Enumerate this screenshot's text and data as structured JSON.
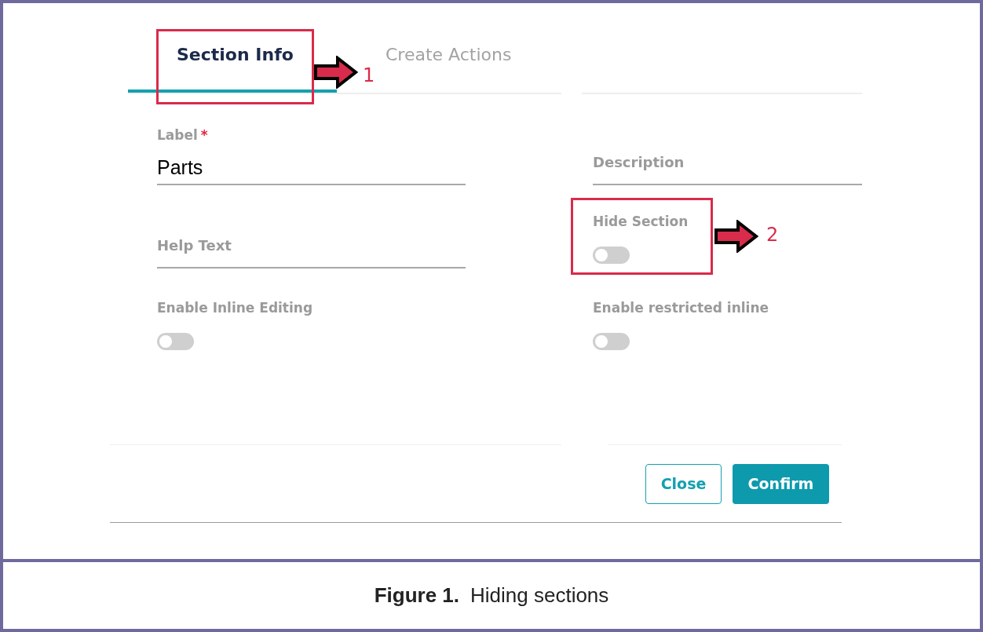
{
  "tabs": [
    {
      "label": "Section Info",
      "selected": true
    },
    {
      "label": "Create Actions",
      "selected": false
    }
  ],
  "form": {
    "label_field": {
      "label": "Label",
      "required_mark": "*",
      "value": "Parts"
    },
    "description_field": {
      "placeholder": "Description"
    },
    "hide_section": {
      "label": "Hide Section",
      "on": false
    },
    "help_text_field": {
      "placeholder": "Help Text"
    },
    "enable_inline_editing": {
      "label": "Enable Inline Editing",
      "on": false
    },
    "enable_restricted_inline": {
      "label": "Enable restricted inline",
      "on": false
    }
  },
  "buttons": [
    {
      "label": "Close",
      "kind": "outline"
    },
    {
      "label": "Confirm",
      "kind": "primary"
    }
  ],
  "callouts": [
    {
      "number": "1"
    },
    {
      "number": "2"
    }
  ],
  "caption": {
    "label": "Figure 1.",
    "text": "Hiding sections"
  }
}
